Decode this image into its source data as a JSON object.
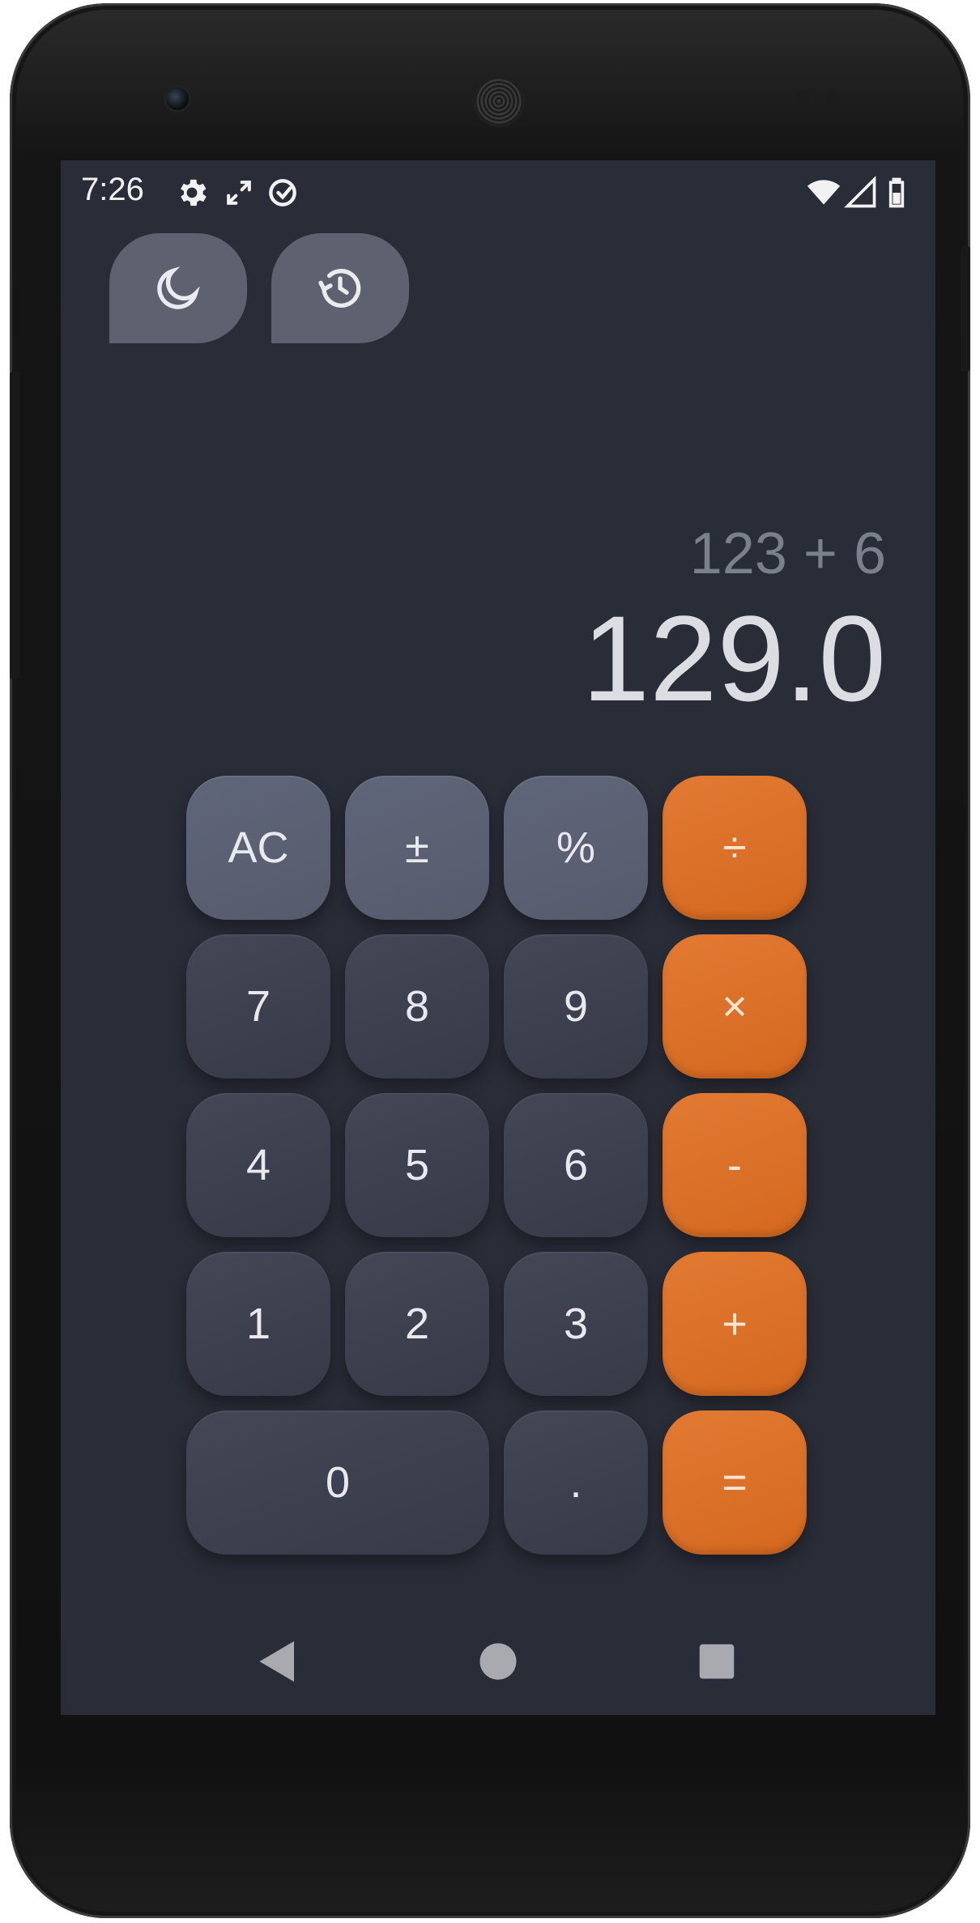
{
  "status_bar": {
    "time": "7:26",
    "left_icons": [
      "gear-icon",
      "expand-arrows-icon",
      "data-saver-icon"
    ],
    "right_icons": [
      "wifi-icon",
      "cell-signal-icon",
      "battery-icon"
    ]
  },
  "toolbar": {
    "theme_toggle_icon": "moon-icon",
    "history_icon": "history-icon"
  },
  "display": {
    "expression": "123 + 6",
    "result": "129.0"
  },
  "keypad": {
    "rows": [
      [
        "AC",
        "±",
        "%",
        "÷"
      ],
      [
        "7",
        "8",
        "9",
        "×"
      ],
      [
        "4",
        "5",
        "6",
        "-"
      ],
      [
        "1",
        "2",
        "3",
        "+"
      ],
      [
        "0",
        ".",
        "="
      ]
    ]
  },
  "nav_bar": {
    "icons": [
      "back-triangle-icon",
      "home-circle-icon",
      "recents-square-icon"
    ]
  },
  "colors": {
    "screen_bg": "#292d38",
    "number_key": "#3c3f4c",
    "function_key": "#5b6072",
    "operator_key": "#dc7129",
    "expression_text": "#7b808d",
    "result_text": "#dcdde2"
  }
}
